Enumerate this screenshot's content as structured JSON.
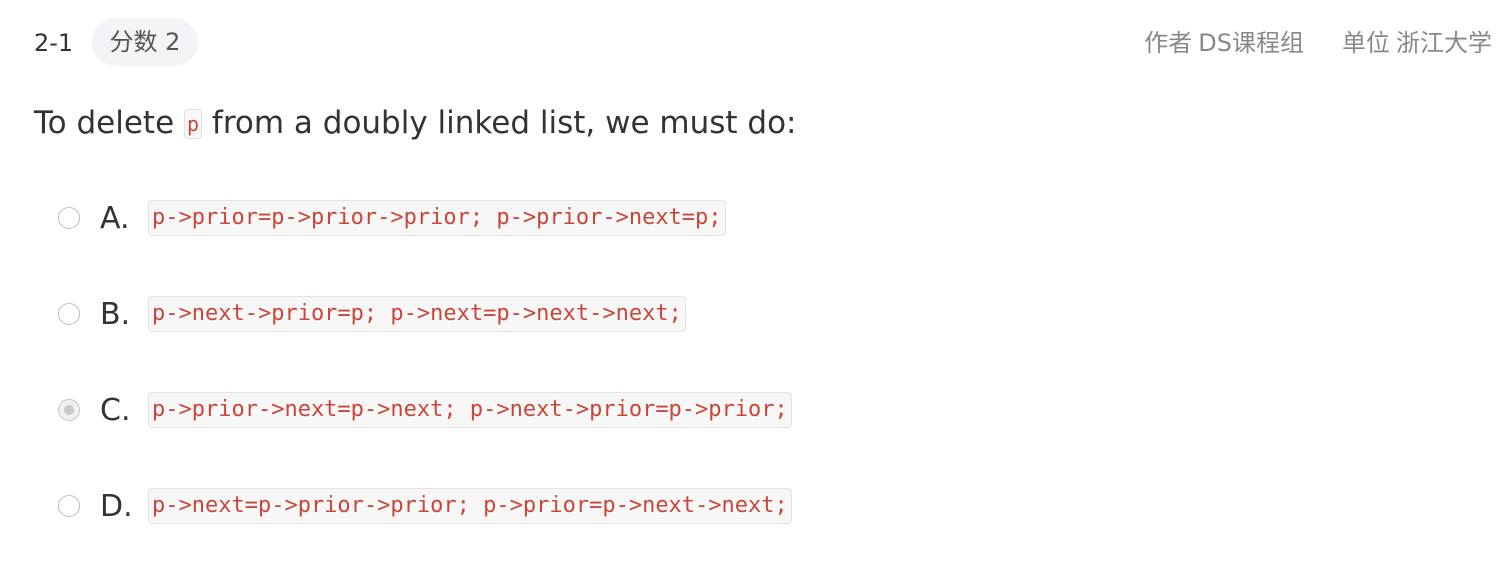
{
  "header": {
    "question_number": "2-1",
    "score": "分数 2",
    "author_label": "作者",
    "author": "DS课程组",
    "unit_label": "单位",
    "unit": "浙江大学"
  },
  "question": {
    "text_before": "To delete",
    "code": "p",
    "text_after": "from a doubly linked list, we must do:"
  },
  "options": [
    {
      "label": "A.",
      "code": "p->prior=p->prior->prior; p->prior->next=p;",
      "selected": false
    },
    {
      "label": "B.",
      "code": "p->next->prior=p; p->next=p->next->next;",
      "selected": false
    },
    {
      "label": "C.",
      "code": "p->prior->next=p->next; p->next->prior=p->prior;",
      "selected": true
    },
    {
      "label": "D.",
      "code": "p->next=p->prior->prior; p->prior=p->next->next;",
      "selected": false
    }
  ],
  "colors": {
    "code_text": "#c9473a",
    "badge_bg": "#f2f4f7",
    "meta_text": "#888888"
  }
}
